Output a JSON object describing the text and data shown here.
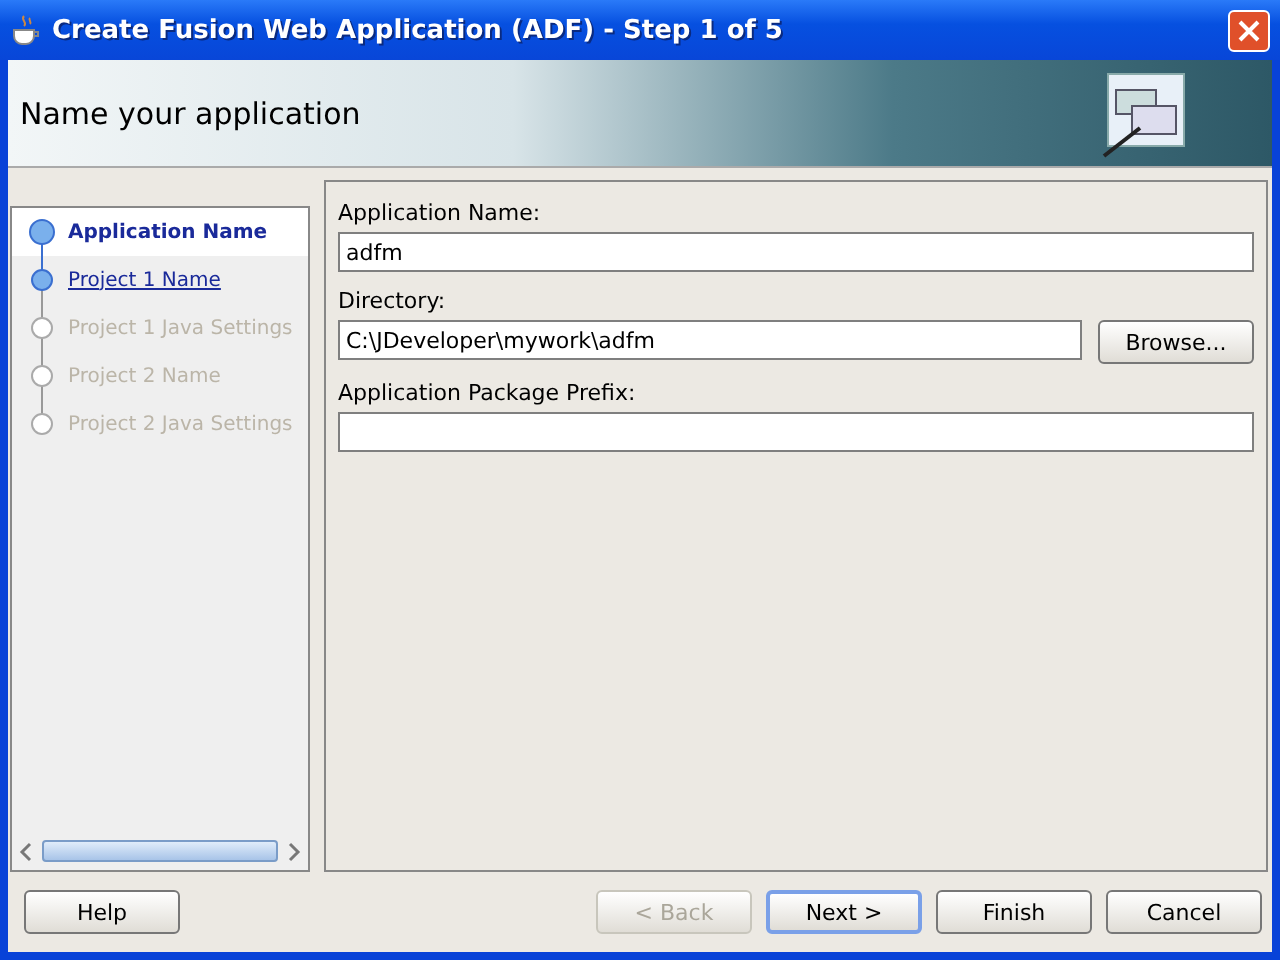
{
  "window": {
    "title": "Create Fusion Web Application (ADF) - Step 1 of 5"
  },
  "header": {
    "title": "Name your application"
  },
  "steps": [
    {
      "label": "Application Name",
      "selected": true,
      "disabled": false
    },
    {
      "label": "Project 1 Name",
      "selected": false,
      "disabled": false
    },
    {
      "label": "Project 1 Java Settings",
      "selected": false,
      "disabled": true
    },
    {
      "label": "Project 2 Name",
      "selected": false,
      "disabled": true
    },
    {
      "label": "Project 2 Java Settings",
      "selected": false,
      "disabled": true
    }
  ],
  "fields": [
    {
      "label": "Application Name:",
      "value": "adfm"
    },
    {
      "label": "Directory:",
      "value": "C:\\JDeveloper\\mywork\\adfm",
      "button": "Browse..."
    },
    {
      "label": "Application Package Prefix:"
    }
  ],
  "buttons": [
    {
      "label": "Help",
      "disabled": false,
      "default": false
    },
    {
      "label": "< Back",
      "disabled": true,
      "default": false
    },
    {
      "label": "Next >",
      "disabled": false,
      "default": true
    },
    {
      "label": "Finish",
      "disabled": false,
      "default": false
    },
    {
      "label": "Cancel",
      "disabled": false,
      "default": false
    }
  ]
}
